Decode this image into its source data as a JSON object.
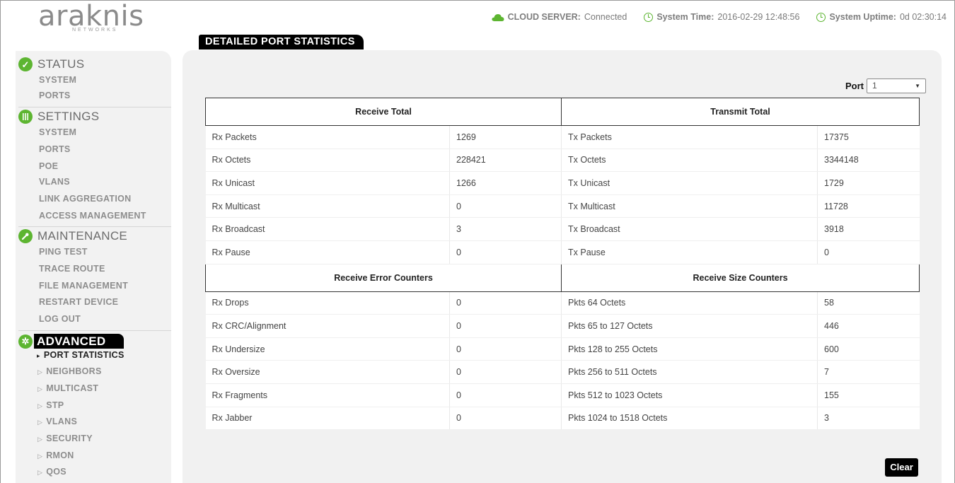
{
  "brand": {
    "name": "araknis",
    "sub": "NETWORKS"
  },
  "header": {
    "cloud_label": "CLOUD SERVER:",
    "cloud_value": "Connected",
    "time_label": "System Time:",
    "time_value": "2016-02-29 12:48:56",
    "uptime_label": "System Uptime:",
    "uptime_value": "0d 02:30:14"
  },
  "colors": {
    "accent": "#5db531",
    "panel": "#f1f1f1",
    "active": "#000000"
  },
  "sidebar": {
    "status": {
      "label": "STATUS",
      "icon": "check-icon",
      "items": [
        "SYSTEM",
        "PORTS"
      ]
    },
    "settings": {
      "label": "SETTINGS",
      "icon": "sliders-icon",
      "items": [
        "SYSTEM",
        "PORTS",
        "POE",
        "VLANS",
        "LINK AGGREGATION",
        "ACCESS MANAGEMENT"
      ]
    },
    "maintenance": {
      "label": "MAINTENANCE",
      "icon": "wrench-icon",
      "items": [
        "PING TEST",
        "TRACE ROUTE",
        "FILE MANAGEMENT",
        "RESTART DEVICE",
        "LOG OUT"
      ]
    },
    "advanced": {
      "label": "ADVANCED",
      "icon": "gear-icon",
      "items": [
        "PORT STATISTICS",
        "NEIGHBORS",
        "MULTICAST",
        "STP",
        "VLANS",
        "SECURITY",
        "RMON",
        "QOS"
      ],
      "current": "PORT STATISTICS"
    }
  },
  "page_title": "DETAILED PORT STATISTICS",
  "port": {
    "label": "Port",
    "value": "1"
  },
  "table": {
    "section1": {
      "left": "Receive Total",
      "right": "Transmit Total"
    },
    "rows1": [
      [
        "Rx Packets",
        "1269",
        "Tx Packets",
        "17375"
      ],
      [
        "Rx Octets",
        "228421",
        "Tx Octets",
        "3344148"
      ],
      [
        "Rx Unicast",
        "1266",
        "Tx Unicast",
        "1729"
      ],
      [
        "Rx Multicast",
        "0",
        "Tx Multicast",
        "11728"
      ],
      [
        "Rx Broadcast",
        "3",
        "Tx Broadcast",
        "3918"
      ],
      [
        "Rx Pause",
        "0",
        "Tx Pause",
        "0"
      ]
    ],
    "section2": {
      "left": "Receive Error Counters",
      "right": "Receive Size Counters"
    },
    "rows2": [
      [
        "Rx Drops",
        "0",
        "Pkts 64 Octets",
        "58"
      ],
      [
        "Rx CRC/Alignment",
        "0",
        "Pkts 65 to 127 Octets",
        "446"
      ],
      [
        "Rx Undersize",
        "0",
        "Pkts 128 to 255 Octets",
        "600"
      ],
      [
        "Rx Oversize",
        "0",
        "Pkts 256 to 511 Octets",
        "7"
      ],
      [
        "Rx Fragments",
        "0",
        "Pkts 512 to 1023 Octets",
        "155"
      ],
      [
        "Rx Jabber",
        "0",
        "Pkts 1024 to 1518 Octets",
        "3"
      ]
    ]
  },
  "clear_label": "Clear"
}
